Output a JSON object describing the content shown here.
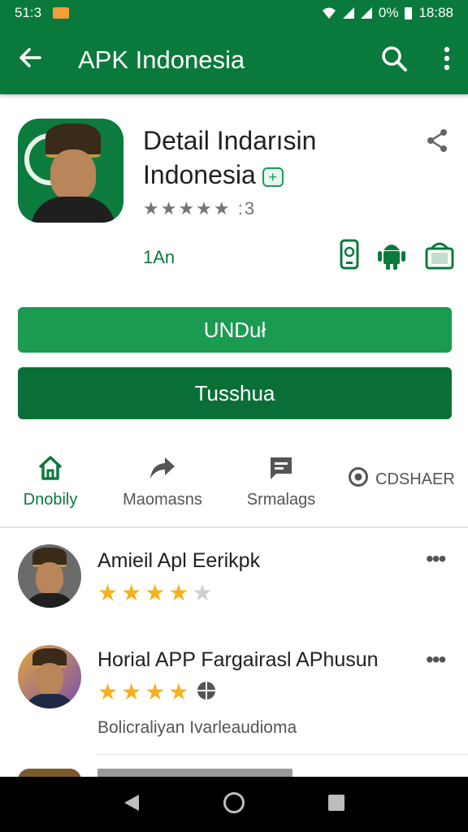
{
  "status_bar": {
    "time": "51:3",
    "battery_percent": "0%",
    "clock": "18:88"
  },
  "app_bar": {
    "title": "APK Indonesia",
    "back_icon": "arrow-left-icon",
    "search_icon": "search-icon",
    "menu_icon": "more-vert-icon"
  },
  "app": {
    "title_line1": "Detail Indarısin",
    "title_line2": "Indonesia",
    "rating_text": "★★★★★ :3",
    "size": "1An",
    "devices": [
      "phone-icon",
      "android-icon",
      "tablet-icon"
    ]
  },
  "buttons": {
    "primary": "UNDuł",
    "secondary": "Tusshua"
  },
  "tabs": [
    {
      "label": "Dnobily",
      "icon": "home-icon",
      "active": true
    },
    {
      "label": "Maomasns",
      "icon": "share-arrow-icon",
      "active": false
    },
    {
      "label": "Srmalags",
      "icon": "message-icon",
      "active": false
    },
    {
      "label": "CDSHAER",
      "icon": "radio-icon",
      "active": false
    }
  ],
  "reviews": [
    {
      "name": "Amieil Apl Eerikpk",
      "stars": 4,
      "max_stars": 5,
      "text": ""
    },
    {
      "name": "Horial APP Fargairasl APhusun",
      "stars": 4,
      "max_stars": 5,
      "text": "Bolicraliyan Ivarleaudioma"
    }
  ],
  "colors": {
    "primary": "#0a7a3c",
    "button_primary": "#1b9a52",
    "button_secondary": "#0a6f37",
    "star": "#f4b21f"
  }
}
